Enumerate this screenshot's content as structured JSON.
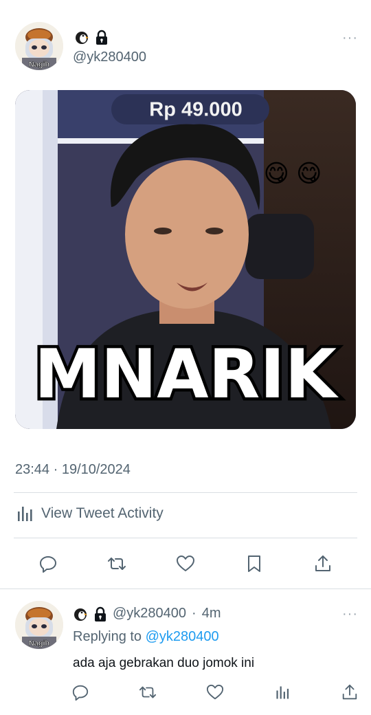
{
  "main_tweet": {
    "handle": "@yk280400",
    "media": {
      "price_tag": "Rp 49.000",
      "caption": "MNARIK",
      "reaction_emoji": "😋 😋"
    },
    "timestamp": "23:44 · 19/10/2024",
    "activity_label": "View Tweet Activity",
    "actions": [
      "reply-icon",
      "retweet-icon",
      "like-icon",
      "bookmark-icon",
      "share-icon"
    ]
  },
  "reply": {
    "handle": "@yk280400",
    "separator": "·",
    "time": "4m",
    "replying_prefix": "Replying to ",
    "replying_handle": "@yk280400",
    "text": "ada aja gebrakan duo jomok ini",
    "actions": [
      "reply-icon",
      "retweet-icon",
      "like-icon",
      "activity-icon",
      "share-icon"
    ]
  },
  "avatar": {
    "label": "Nagih"
  },
  "colors": {
    "link": "#1d9bf0",
    "secondary_text": "#536471",
    "divider": "#d9dee2"
  },
  "more_label": "···"
}
